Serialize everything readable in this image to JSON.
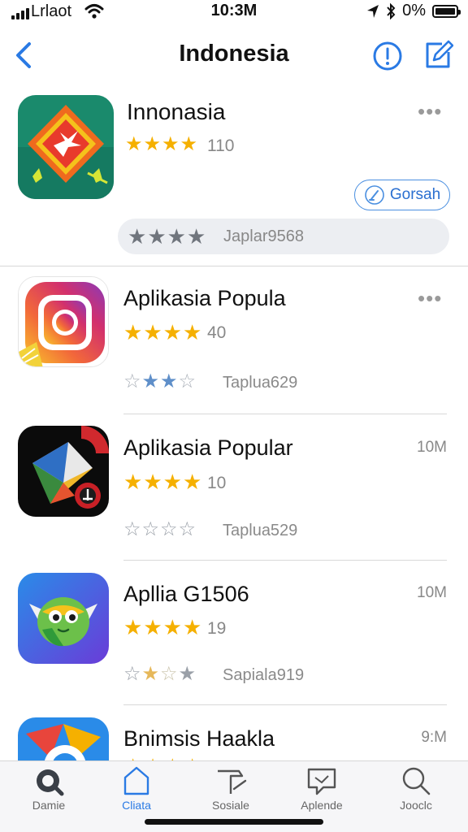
{
  "status": {
    "carrier": "Lrlaot",
    "time": "10:3M",
    "battery": "0%"
  },
  "nav": {
    "title": "Indonesia"
  },
  "featured": {
    "name": "Innonasia",
    "rating_count": "110",
    "get_label": "Gorsah",
    "tag_label": "Japlar9568",
    "stars_filled": 4
  },
  "apps": [
    {
      "name": "Aplikasia Popula",
      "rating_count": "40",
      "size": "",
      "sub_tag": "Taplua629",
      "menu": "•••"
    },
    {
      "name": "Aplikasia Popular",
      "rating_count": "10",
      "size": "10M",
      "sub_tag": "Taplua529",
      "menu": ""
    },
    {
      "name": "Apllia G1506",
      "rating_count": "19",
      "size": "10M",
      "sub_tag": "Sapiala919",
      "menu": ""
    },
    {
      "name": "Bnimsis Haakla",
      "rating_count": "",
      "size": "9:M",
      "sub_tag": "",
      "menu": ""
    }
  ],
  "more_label": "•••",
  "tabs": [
    {
      "label": "Damie",
      "icon": "game-icon"
    },
    {
      "label": "Cliata",
      "icon": "apps-icon"
    },
    {
      "label": "Sosiale",
      "icon": "hammer-icon"
    },
    {
      "label": "Aplende",
      "icon": "chat-icon"
    },
    {
      "label": "Jooclc",
      "icon": "search-icon"
    }
  ],
  "colors": {
    "accent": "#2a7ae4",
    "star": "#f5b000",
    "star_muted": "#9aa0a8"
  }
}
